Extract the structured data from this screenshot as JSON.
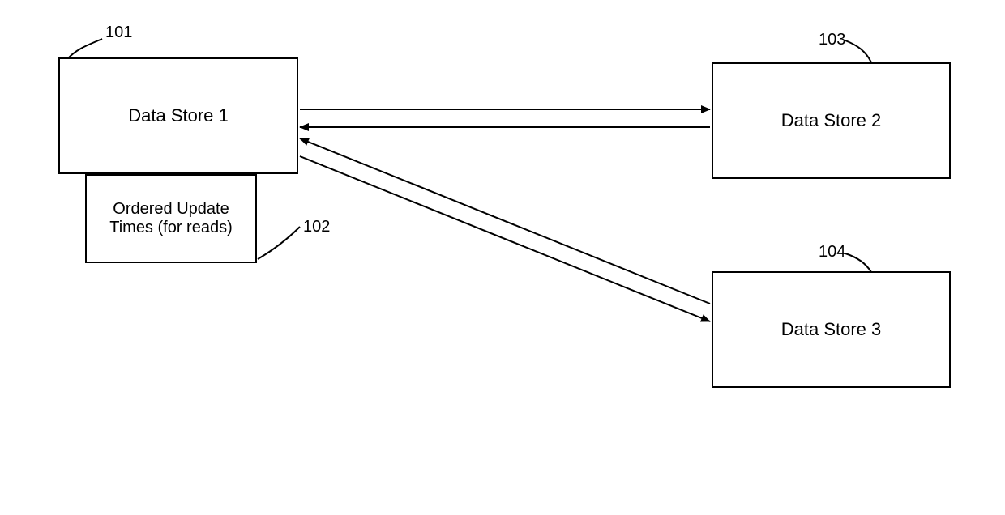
{
  "boxes": {
    "ds1": "Data Store 1",
    "ds2": "Data Store 2",
    "ds3": "Data Store 3",
    "updates": "Ordered Update\nTimes (for reads)"
  },
  "labels": {
    "l101": "101",
    "l102": "102",
    "l103": "103",
    "l104": "104"
  }
}
